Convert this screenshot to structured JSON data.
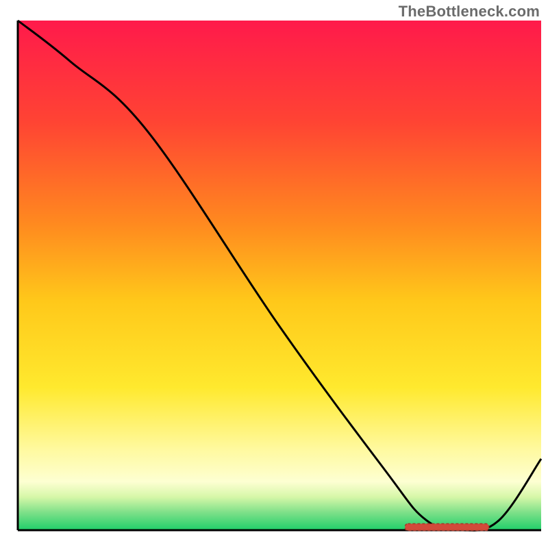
{
  "watermark": "TheBottleneck.com",
  "chart_data": {
    "type": "line",
    "title": "",
    "xlabel": "",
    "ylabel": "",
    "xlim": [
      0,
      100
    ],
    "ylim": [
      0,
      100
    ],
    "grid": false,
    "series": [
      {
        "name": "curve",
        "x": [
          0,
          10,
          25,
          50,
          70,
          78,
          85,
          92,
          100
        ],
        "y": [
          100,
          92,
          78,
          40,
          12,
          2,
          0,
          2,
          14
        ],
        "color": "#000000"
      }
    ],
    "marker_band": {
      "name": "optimal-range",
      "x_start": 74,
      "x_end": 90,
      "y": 0.6,
      "color_fill": "#d24a3a",
      "color_stroke": "#a6392c"
    },
    "background_gradient": {
      "stops": [
        {
          "offset": 0.0,
          "color": "#ff1a4b"
        },
        {
          "offset": 0.2,
          "color": "#ff4433"
        },
        {
          "offset": 0.4,
          "color": "#ff8a1f"
        },
        {
          "offset": 0.55,
          "color": "#ffc81a"
        },
        {
          "offset": 0.72,
          "color": "#ffe92e"
        },
        {
          "offset": 0.84,
          "color": "#fff99e"
        },
        {
          "offset": 0.905,
          "color": "#fdffd2"
        },
        {
          "offset": 0.935,
          "color": "#d6f7a8"
        },
        {
          "offset": 0.965,
          "color": "#7ee089"
        },
        {
          "offset": 1.0,
          "color": "#1fcf6a"
        }
      ]
    },
    "axes": {
      "left": {
        "x": 3.3
      },
      "bottom": {
        "y": 3.3
      }
    }
  }
}
